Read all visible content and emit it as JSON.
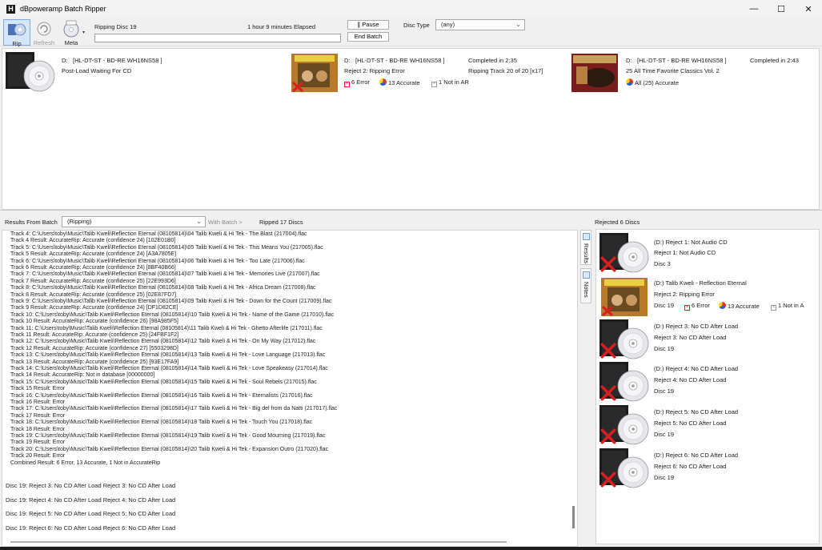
{
  "window": {
    "title": "dBpoweramp Batch Ripper",
    "minimize": "—",
    "maximize": "☐",
    "close": "✕"
  },
  "toolbar": {
    "rip_label": "Rip",
    "refresh_label": "Refresh",
    "meta_label": "Meta",
    "meta_dropdown": "▾"
  },
  "status": {
    "ripping": "Ripping Disc 19",
    "elapsed": "1 hour 9 minutes Elapsed",
    "progress": 0
  },
  "buttons": {
    "pause": "∥ Pause",
    "end_batch": "End Batch"
  },
  "disc_type": {
    "label": "Disc Type",
    "value": "(any)"
  },
  "drives": [
    {
      "drive": "D:",
      "model": "[HL-DT-ST - BD-RE  WH16NS58 ]",
      "status": "Post-Load Waiting For CD"
    },
    {
      "drive": "D:",
      "model": "[HL-DT-ST - BD-RE  WH16NS58 ]",
      "completed": "Completed in 2:35",
      "status": "Reject 2: Ripping Error",
      "track": "Ripping Track 20 of 20   [x17]",
      "errors": "6 Error",
      "accurate": "13 Accurate",
      "not_in_ar": "1 Not in AR"
    },
    {
      "drive": "D:",
      "model": "[HL-DT-ST - BD-RE  WH16NS58 ]",
      "completed": "Completed in 2:43",
      "status": "25 All Time Favorite Classics Vol. 2",
      "accurate": "All (25) Accurate"
    }
  ],
  "results": {
    "label": "Results From Batch",
    "selected": "(Ripping)",
    "with_batch": "With Batch >",
    "ripped": "Ripped 17 Discs"
  },
  "log": [
    "Track 4: C:\\Users\\toby\\Music\\Talib Kweli\\Reflection Eternal (08105814)\\04 Talib Kweli & Hi Tek - The Blast (217004).flac",
    "Track 4 Result: AccurateRip: Accurate (confidence 24)   [102E01B0]",
    "Track 5: C:\\Users\\toby\\Music\\Talib Kweli\\Reflection Eternal (08105814)\\05 Talib Kweli & Hi Tek - This Means You (217005).flac",
    "Track 5 Result: AccurateRip: Accurate (confidence 24)   [A3A7805E]",
    "Track 6: C:\\Users\\toby\\Music\\Talib Kweli\\Reflection Eternal (08105814)\\06 Talib Kweli & Hi Tek - Too Late (217006).flac",
    "Track 6 Result: AccurateRip: Accurate (confidence 24)   [8BF40B66]",
    "Track 7: C:\\Users\\toby\\Music\\Talib Kweli\\Reflection Eternal (08105814)\\07 Talib Kweli & Hi Tek - Memories Live (217007).flac",
    "Track 7 Result: AccurateRip: Accurate (confidence 25)   [22E993D6]",
    "Track 8: C:\\Users\\toby\\Music\\Talib Kweli\\Reflection Eternal (08105814)\\08 Talib Kweli & Hi Tek - Africa Dream (217008).flac",
    "Track 8 Result: AccurateRip: Accurate (confidence 25)   [02E87FD7]",
    "Track 9: C:\\Users\\toby\\Music\\Talib Kweli\\Reflection Eternal (08105814)\\09 Talib Kweli & Hi Tek - Down for the Count (217009).flac",
    "Track 9 Result: AccurateRip: Accurate (confidence 24)   [DF1D82CE]",
    "Track 10: C:\\Users\\toby\\Music\\Talib Kweli\\Reflection Eternal (08105814)\\10 Talib Kweli & Hi Tek - Name of the Game (217010).flac",
    "Track 10 Result: AccurateRip: Accurate (confidence 26)   [98A985F5]",
    "Track 11: C:\\Users\\toby\\Music\\Talib Kweli\\Reflection Eternal (08105814)\\11 Talib Kweli & Hi Tek - Ghetto Afterlife (217011).flac",
    "Track 11 Result: AccurateRip: Accurate (confidence 25)   [24FBF1F2]",
    "Track 12: C:\\Users\\toby\\Music\\Talib Kweli\\Reflection Eternal (08105814)\\12 Talib Kweli & Hi Tek - On My Way (217012).flac",
    "Track 12 Result: AccurateRip: Accurate (confidence 27)   [5503298D]",
    "Track 13: C:\\Users\\toby\\Music\\Talib Kweli\\Reflection Eternal (08105814)\\13 Talib Kweli & Hi Tek - Love Language (217013).flac",
    "Track 13 Result: AccurateRip: Accurate (confidence 25)   [93E17FA9]",
    "Track 14: C:\\Users\\toby\\Music\\Talib Kweli\\Reflection Eternal (08105814)\\14 Talib Kweli & Hi Tek - Love Speakeasy (217014).flac",
    "Track 14 Result: AccurateRip: Not in database   [00000000]",
    "Track 15: C:\\Users\\toby\\Music\\Talib Kweli\\Reflection Eternal (08105814)\\15 Talib Kweli & Hi Tek - Soul Rebels (217015).flac",
    "Track 15 Result: Error",
    "Track 16: C:\\Users\\toby\\Music\\Talib Kweli\\Reflection Eternal (08105814)\\16 Talib Kweli & Hi Tek - Eternalists (217016).flac",
    "Track 16 Result: Error",
    "Track 17: C:\\Users\\toby\\Music\\Talib Kweli\\Reflection Eternal (08105814)\\17 Talib Kweli & Hi Tek - Big del from da Natti (217017).flac",
    "Track 17 Result: Error",
    "Track 18: C:\\Users\\toby\\Music\\Talib Kweli\\Reflection Eternal (08105814)\\18 Talib Kweli & Hi Tek - Touch You (217018).flac",
    "Track 18 Result: Error",
    "Track 19: C:\\Users\\toby\\Music\\Talib Kweli\\Reflection Eternal (08105814)\\19 Talib Kweli & Hi Tek - Good Mourning (217019).flac",
    "Track 19 Result: Error",
    "Track 20: C:\\Users\\toby\\Music\\Talib Kweli\\Reflection Eternal (08105814)\\20 Talib Kweli & Hi Tek - Expansion Outro (217020).flac",
    "Track 20 Result: Error",
    "Combined Result: 6 Error,  13 Accurate,  1 Not in AccurateRip"
  ],
  "log_discs": [
    "Disc 19: Reject 3: No CD After Load   Reject 3: No CD After Load",
    "Disc 19: Reject 4: No CD After Load   Reject 4: No CD After Load",
    "Disc 19: Reject 5: No CD After Load   Reject 5: No CD After Load",
    "Disc 19: Reject 6: No CD After Load   Reject 6: No CD After Load"
  ],
  "side_tabs": {
    "results": "Results",
    "notes": "Notes"
  },
  "rejected": {
    "title": "Rejected 6 Discs",
    "items": [
      {
        "line1": "(D:)  Reject 1: Not Audio CD",
        "line2": "Reject 1: Not Audio CD",
        "line3": "Disc 3"
      },
      {
        "line1": "(D:)  Talib Kweli - Reflection Eternal",
        "line2": "Reject 2: Ripping Error",
        "line3": "Disc 19",
        "errors": "6 Error",
        "accurate": "13 Accurate",
        "not_in_ar": "1 Not in A"
      },
      {
        "line1": "(D:)  Reject 3: No CD After Load",
        "line2": "Reject 3: No CD After Load",
        "line3": "Disc 19"
      },
      {
        "line1": "(D:)  Reject 4: No CD After Load",
        "line2": "Reject 4: No CD After Load",
        "line3": "Disc 19"
      },
      {
        "line1": "(D:)  Reject 5: No CD After Load",
        "line2": "Reject 5: No CD After Load",
        "line3": "Disc 19"
      },
      {
        "line1": "(D:)  Reject 6: No CD After Load",
        "line2": "Reject 6: No CD After Load",
        "line3": "Disc 19"
      }
    ]
  }
}
